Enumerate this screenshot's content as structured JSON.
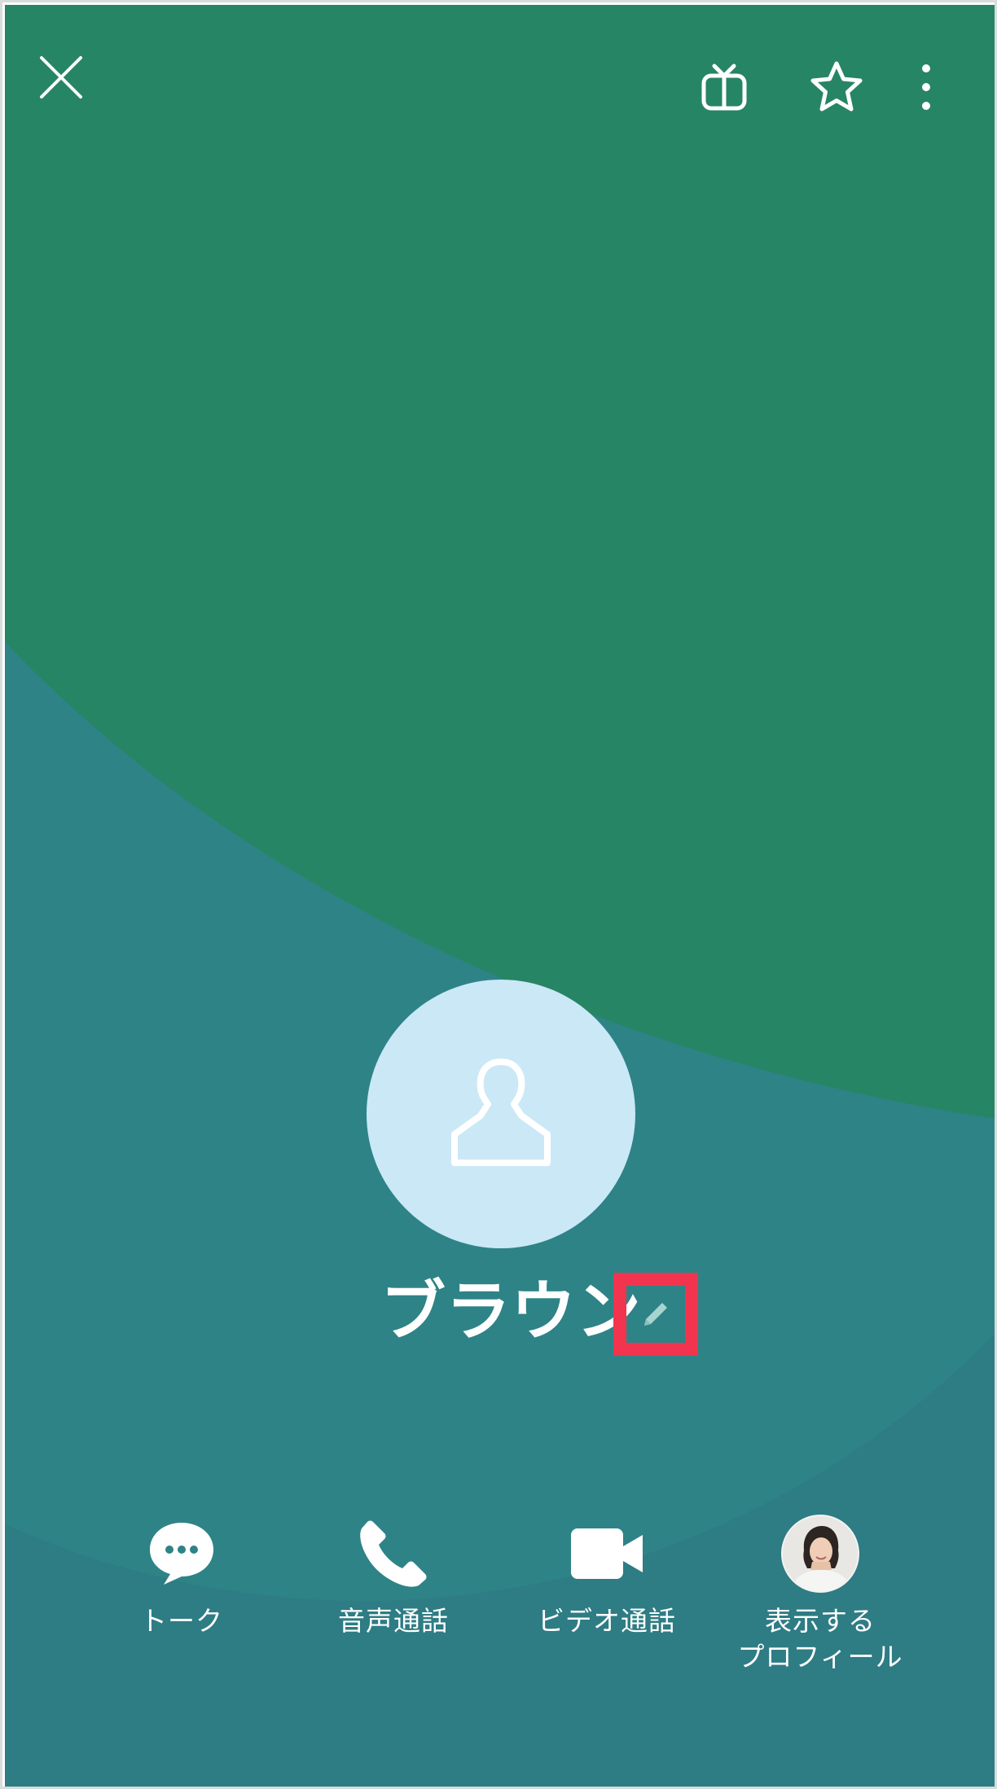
{
  "colors": {
    "bg_teal": "#2e8387",
    "bg_teal_deep": "#2e7c84",
    "bg_green": "#268564",
    "avatar_bg": "#cbe8f7",
    "highlight": "#f3344f"
  },
  "header": {
    "close_icon": "close-icon",
    "gift_icon": "gift-icon",
    "star_icon": "star-icon",
    "more_icon": "more-vertical-icon"
  },
  "profile": {
    "name": "ブラウン",
    "avatar_icon": "person-outline-icon",
    "edit_icon": "pencil-icon"
  },
  "actions": [
    {
      "label": "トーク",
      "icon": "chat-bubble-icon"
    },
    {
      "label": "音声通話",
      "icon": "phone-icon"
    },
    {
      "label": "ビデオ通話",
      "icon": "video-camera-icon"
    },
    {
      "label_line1": "表示する",
      "label_line2": "プロフィール",
      "icon": "profile-photo"
    }
  ]
}
